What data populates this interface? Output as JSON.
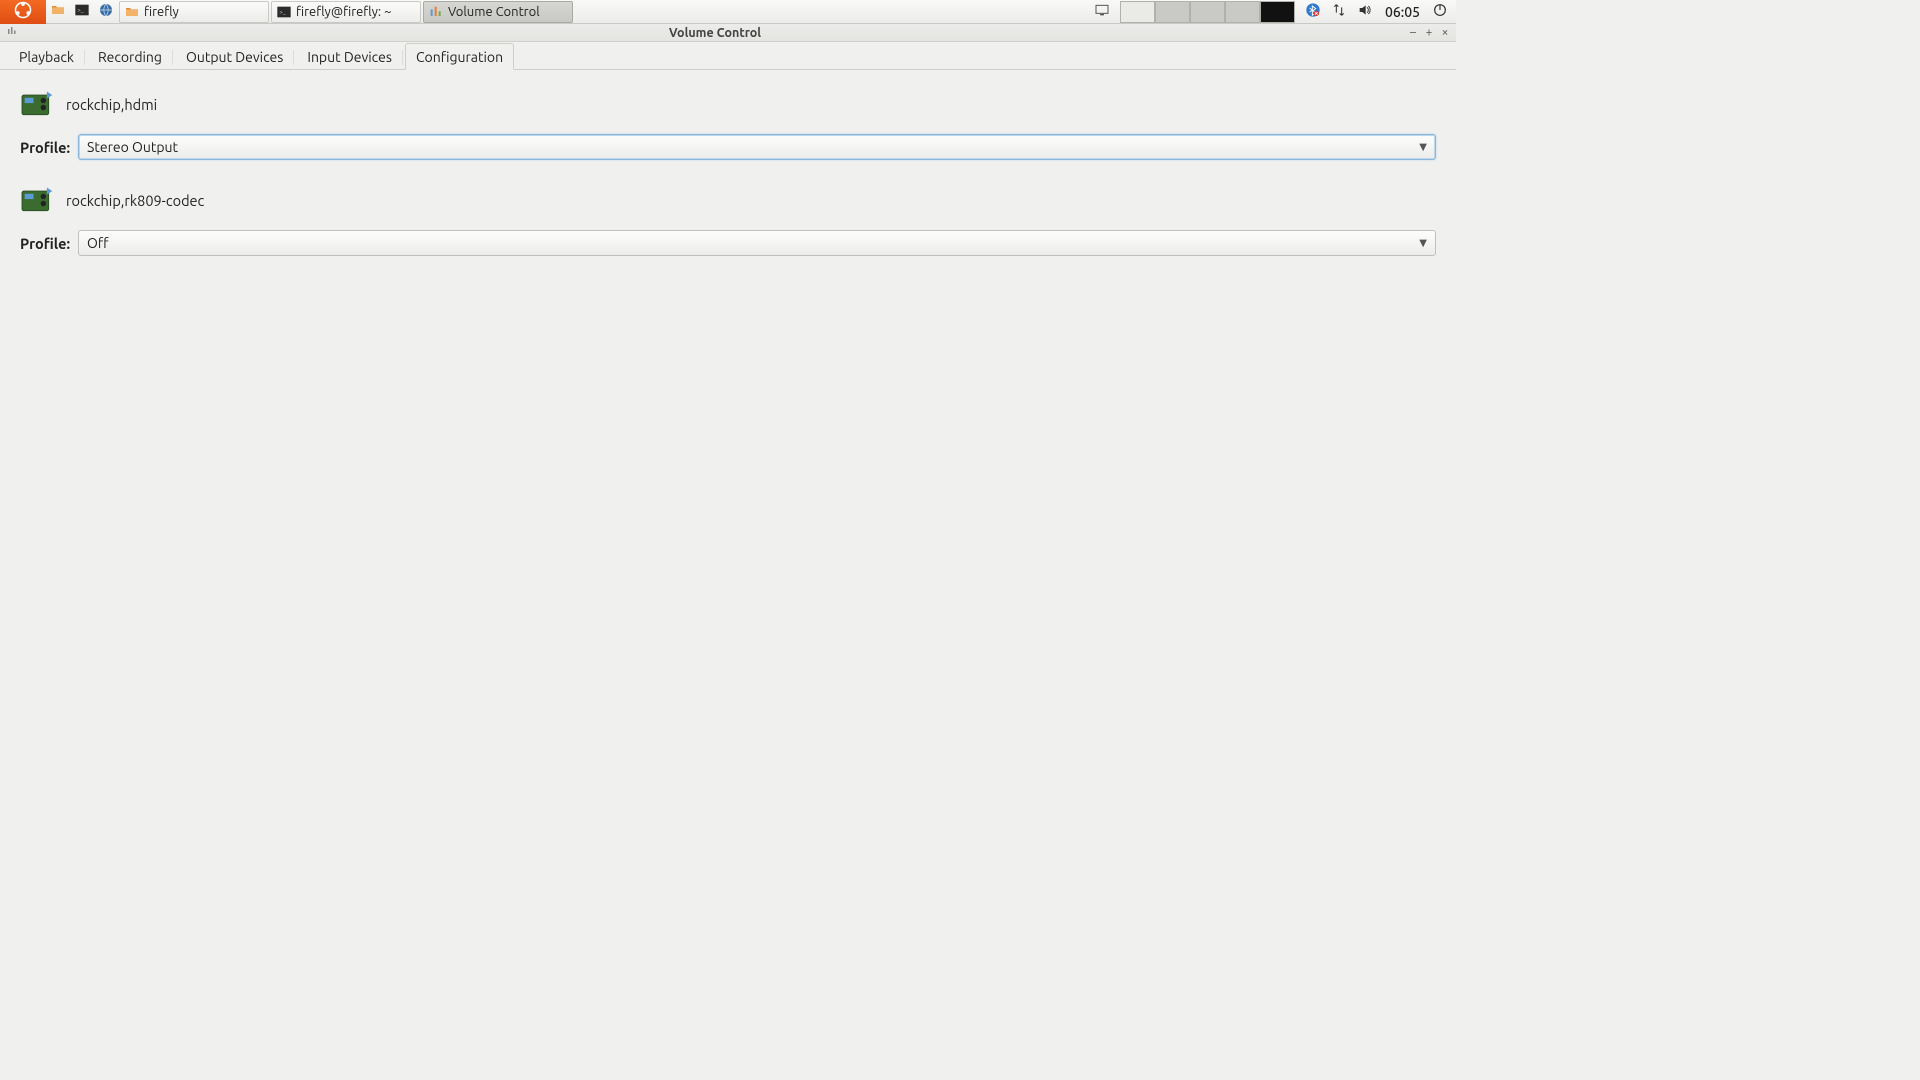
{
  "taskbar": {
    "items": [
      {
        "label": "firefly"
      },
      {
        "label": "firefly@firefly: ~"
      },
      {
        "label": "Volume Control"
      }
    ],
    "clock": "06:05"
  },
  "window": {
    "title": "Volume Control"
  },
  "tabs": [
    {
      "label": "Playback"
    },
    {
      "label": "Recording"
    },
    {
      "label": "Output Devices"
    },
    {
      "label": "Input Devices"
    },
    {
      "label": "Configuration"
    }
  ],
  "config": {
    "profile_label": "Profile:",
    "devices": [
      {
        "name": "rockchip,hdmi",
        "profile": "Stereo Output"
      },
      {
        "name": "rockchip,rk809-codec",
        "profile": "Off"
      }
    ]
  }
}
